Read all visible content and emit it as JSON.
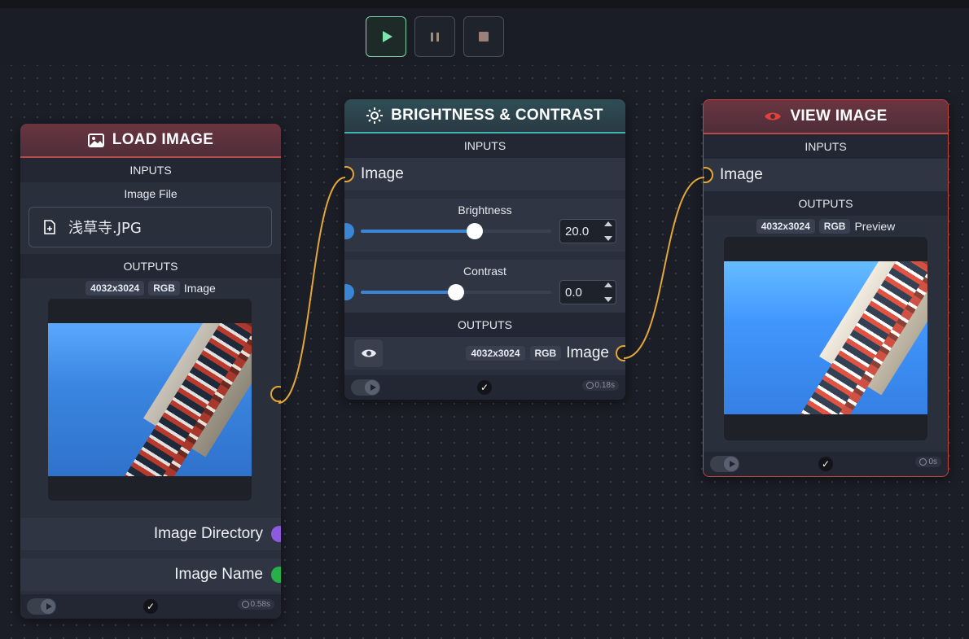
{
  "toolbar": {
    "run_icon": "play-icon",
    "pause_icon": "pause-icon",
    "stop_icon": "stop-icon"
  },
  "colors": {
    "accent_run": "#7fd6a8",
    "load_header": "#6a3540",
    "brightness_header": "#2f4d55",
    "view_header": "#6a3540",
    "wire": "#e4a63a"
  },
  "load_image": {
    "title": "LOAD IMAGE",
    "icon": "image-icon",
    "inputs_label": "INPUTS",
    "image_file_label": "Image File",
    "file_name": "浅草寺.JPG",
    "outputs_label": "OUTPUTS",
    "dims": "4032x3024",
    "mode": "RGB",
    "image_label": "Image",
    "outputs": [
      {
        "label": "Image Directory",
        "color": "#8c5be0"
      },
      {
        "label": "Image Name",
        "color": "#25b146"
      }
    ],
    "time": "0.58s"
  },
  "brightness": {
    "title": "BRIGHTNESS & CONTRAST",
    "icon": "sun-icon",
    "inputs_label": "INPUTS",
    "input_image_label": "Image",
    "brightness_label": "Brightness",
    "brightness_value": "20.0",
    "brightness_fraction": 0.6,
    "contrast_label": "Contrast",
    "contrast_value": "0.0",
    "contrast_fraction": 0.5,
    "outputs_label": "OUTPUTS",
    "dims": "4032x3024",
    "mode": "RGB",
    "output_image_label": "Image",
    "time": "0.18s"
  },
  "view_image": {
    "title": "VIEW IMAGE",
    "icon": "eye-icon",
    "inputs_label": "INPUTS",
    "input_image_label": "Image",
    "outputs_label": "OUTPUTS",
    "dims": "4032x3024",
    "mode": "RGB",
    "preview_label": "Preview",
    "time": "0s"
  }
}
